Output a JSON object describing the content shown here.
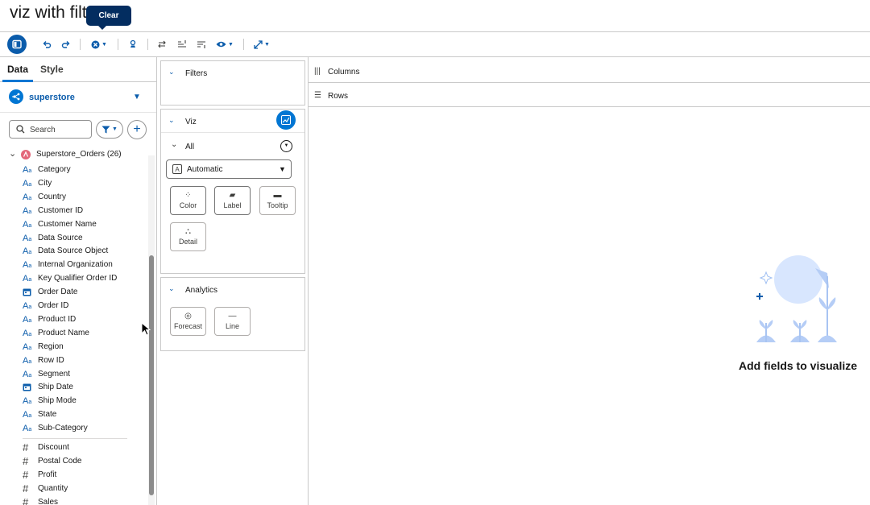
{
  "window": {
    "title": "viz with filt"
  },
  "tooltip": {
    "text": "Clear"
  },
  "toolbar": {
    "buttons": [
      "panel-toggle",
      "undo",
      "redo",
      "clear",
      "pin",
      "swap",
      "sort-asc",
      "sort-desc",
      "show",
      "fit"
    ]
  },
  "left_panel": {
    "tabs": [
      {
        "label": "Data",
        "active": true
      },
      {
        "label": "Style",
        "active": false
      }
    ],
    "datasource": {
      "label": "superstore"
    },
    "search": {
      "placeholder": "Search"
    },
    "object": {
      "label": "Superstore_Orders (26)"
    },
    "dimension_fields": [
      "Category",
      "City",
      "Country",
      "Customer ID",
      "Customer Name",
      "Data Source",
      "Data Source Object",
      "Internal Organization",
      "Key Qualifier Order ID",
      "Order Date",
      "Order ID",
      "Product ID",
      "Product Name",
      "Region",
      "Row ID",
      "Segment",
      "Ship Date",
      "Ship Mode",
      "State",
      "Sub-Category"
    ],
    "date_fields": [
      "Order Date",
      "Ship Date"
    ],
    "measure_fields": [
      "Discount",
      "Postal Code",
      "Profit",
      "Quantity",
      "Sales"
    ]
  },
  "middle_panel": {
    "filters": {
      "label": "Filters"
    },
    "viz": {
      "label": "Viz"
    },
    "all": {
      "label": "All"
    },
    "mark_type": {
      "value": "Automatic"
    },
    "marks": [
      "Color",
      "Label",
      "Tooltip",
      "Detail"
    ],
    "analytics": {
      "label": "Analytics",
      "items": [
        "Forecast",
        "Line"
      ]
    }
  },
  "shelves": {
    "columns": "Columns",
    "rows": "Rows"
  },
  "canvas": {
    "empty_message": "Add fields to visualize"
  },
  "colors": {
    "accent": "#0176d3",
    "brand_dark": "#032d60",
    "link": "#0b5cab"
  }
}
